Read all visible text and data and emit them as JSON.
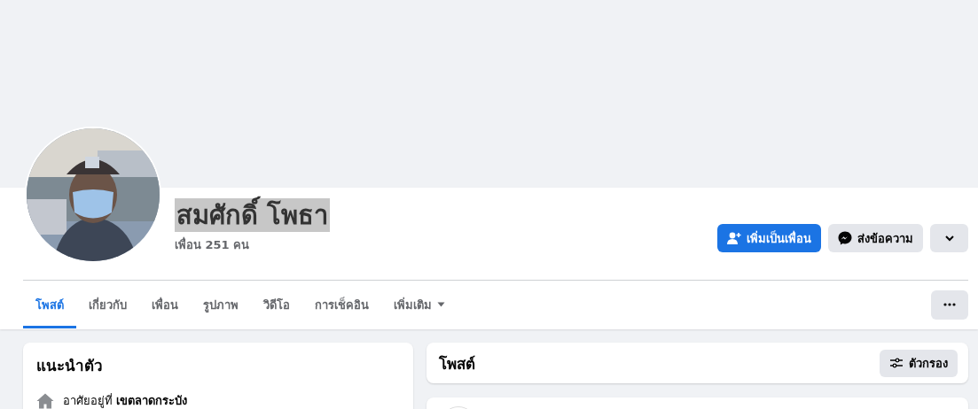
{
  "profile": {
    "name": "สมศักดิ์ โพธา",
    "name_highlighted": true,
    "friends": "เพื่อน 251 คน"
  },
  "actions": [
    {
      "kind": "add-friend",
      "label": "เพิ่มเป็นเพื่อน"
    },
    {
      "kind": "message",
      "label": "ส่งข้อความ"
    },
    {
      "kind": "more"
    }
  ],
  "tabs": [
    {
      "label": "โพสต์",
      "selected": true,
      "dropdown": false
    },
    {
      "label": "เกี่ยวกับ",
      "selected": false,
      "dropdown": false
    },
    {
      "label": "เพื่อน",
      "selected": false,
      "dropdown": false
    },
    {
      "label": "รูปภาพ",
      "selected": false,
      "dropdown": false
    },
    {
      "label": "วิดีโอ",
      "selected": false,
      "dropdown": false
    },
    {
      "label": "การเช็คอิน",
      "selected": false,
      "dropdown": false
    },
    {
      "label": "เพิ่มเติม",
      "selected": false,
      "dropdown": true
    }
  ],
  "intro": {
    "title": "แนะนำตัว",
    "items": [
      {
        "text": "อาศัยอยู่ที่ **เขตลาดกระบัง**"
      }
    ]
  },
  "posts": {
    "title": "โพสต์",
    "filter_button": "ตัวกรอง"
  }
}
